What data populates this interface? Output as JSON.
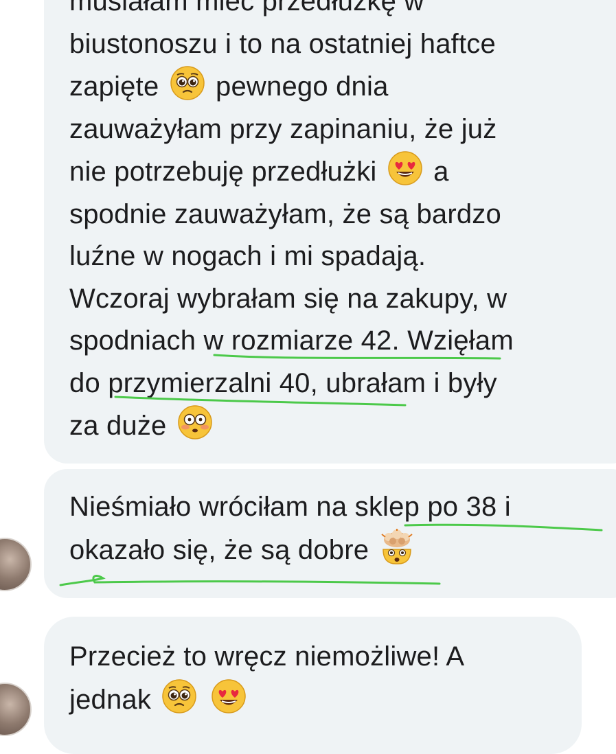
{
  "messages": [
    {
      "lines": [
        [
          "musiałam mieć przedłużkę w"
        ],
        [
          "biustonoszu i to na ostatniej haftce"
        ],
        [
          "zapięte ",
          {
            "emoji": "pleading-face-emoji"
          },
          " pewnego dnia"
        ],
        [
          "zauważyłam przy zapinaniu, że już"
        ],
        [
          "nie potrzebuję przedłużki ",
          {
            "emoji": "heart-eyes-emoji"
          },
          " a"
        ],
        [
          "spodnie zauważyłam, że są bardzo"
        ],
        [
          "luźne w nogach i mi spadają."
        ],
        [
          "Wczoraj wybrałam się na zakupy, w"
        ],
        [
          "spodniach w rozmiarze 42. Wzięłam"
        ],
        [
          "do przymierzalni 40, ubrałam i były"
        ],
        [
          "za duże ",
          {
            "emoji": "flushed-face-emoji"
          }
        ]
      ]
    },
    {
      "lines": [
        [
          "Nieśmiało wróciłam na sklep po 38 i"
        ],
        [
          "okazało się, że są dobre ",
          {
            "emoji": "exploding-head-emoji"
          }
        ]
      ]
    },
    {
      "lines": [
        [
          "Przecież to wręcz niemożliwe! A"
        ],
        [
          "jednak ",
          {
            "emoji": "pleading-face-emoji"
          },
          " ",
          {
            "emoji": "heart-eyes-emoji"
          }
        ]
      ]
    }
  ],
  "colors": {
    "bubble": "#eff3f5",
    "text": "#1c1c1e",
    "highlight_underline": "#4cc94a"
  }
}
